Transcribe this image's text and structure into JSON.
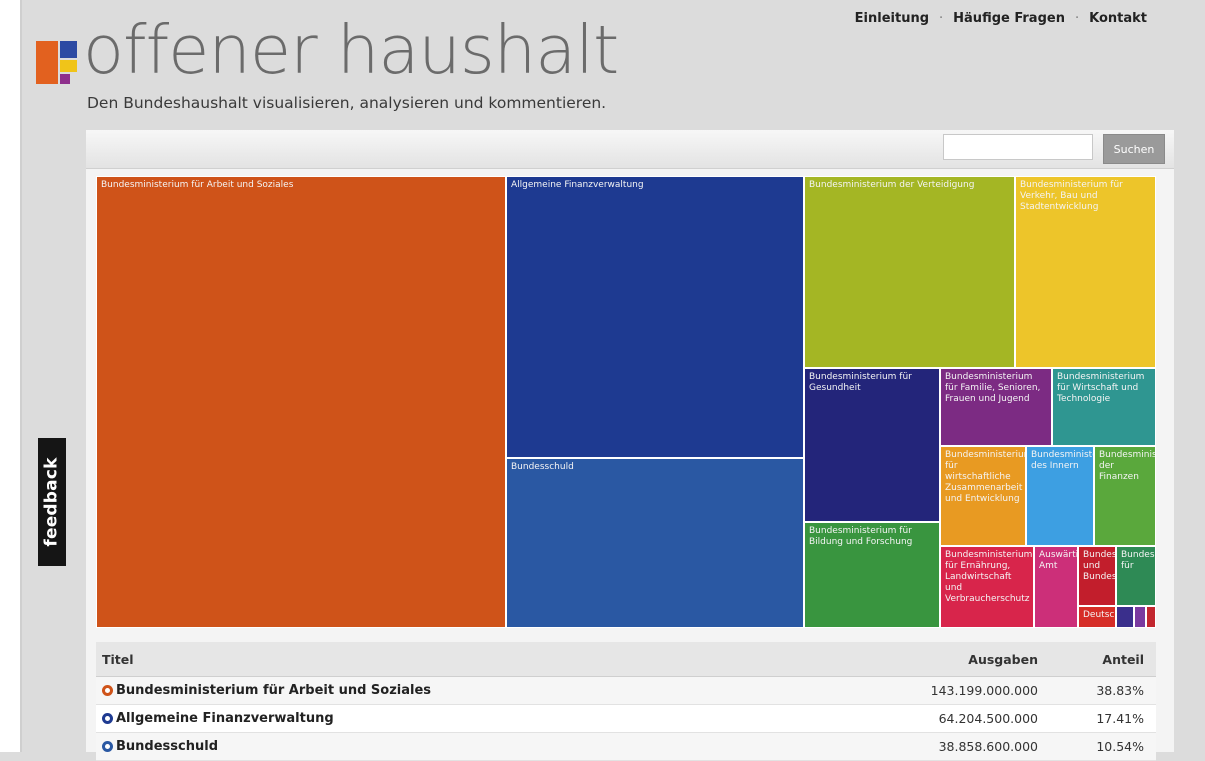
{
  "header": {
    "brand": "offener haushalt",
    "tagline": "Den Bundeshaushalt visualisieren, analysieren und kommentieren.",
    "nav": [
      "Einleitung",
      "Häufige Fragen",
      "Kontakt"
    ],
    "nav_separator": "·",
    "logo_colors": [
      "#e2611f",
      "#2c4aa3",
      "#f0c419",
      "#8e2f8c"
    ]
  },
  "feedback": {
    "label": "feedback"
  },
  "search": {
    "placeholder": "",
    "button_label": "Suchen"
  },
  "chart_data": {
    "type": "treemap",
    "tiles": [
      {
        "label": "Bundesministerium für Arbeit und Soziales",
        "color": "#cf5319"
      },
      {
        "label": "Allgemeine Finanzverwaltung",
        "color": "#1e3a91"
      },
      {
        "label": "Bundesschuld",
        "color": "#2a58a3"
      },
      {
        "label": "Bundesministerium der Verteidigung",
        "color": "#a4b624"
      },
      {
        "label": "Bundesministerium für Verkehr, Bau und Stadtentwicklung",
        "color": "#edc52a"
      },
      {
        "label": "Bundesministerium für Gesundheit",
        "color": "#23257a"
      },
      {
        "label": "Bundesministerium für Bildung und Forschung",
        "color": "#39953f"
      },
      {
        "label": "Bundesministerium für Familie, Senioren, Frauen und Jugend",
        "color": "#7c2b83"
      },
      {
        "label": "Bundesministerium für Wirtschaft und Technologie",
        "color": "#2f9691"
      },
      {
        "label": "Bundesministerium für wirtschaftliche Zusammenarbeit und Entwicklung",
        "color": "#e89a22"
      },
      {
        "label": "Bundesministerium des Innern",
        "color": "#3d9fe2"
      },
      {
        "label": "Bundesministerium der Finanzen",
        "color": "#5aa83c"
      },
      {
        "label": "Bundesministerium für Ernährung, Landwirtschaft und Verbraucherschutz",
        "color": "#d8254b"
      },
      {
        "label": "Auswärtiges Amt",
        "color": "#cc2f79"
      },
      {
        "label": "Bundesministerium und Bundes",
        "color": "#c21e2c"
      },
      {
        "label": "Bundesministerium für",
        "color": "#2e8a55"
      },
      {
        "label": "Deutscher",
        "color": "#d62d27"
      },
      {
        "label": "",
        "color": "#3a2f8c"
      },
      {
        "label": "",
        "color": "#7a3aa0"
      },
      {
        "label": "",
        "color": "#c2262e"
      }
    ]
  },
  "table": {
    "headers": {
      "title": "Titel",
      "amount": "Ausgaben",
      "share": "Anteil"
    },
    "rows": [
      {
        "title": "Bundesministerium für Arbeit und Soziales",
        "amount": "143.199.000.000",
        "share": "38.83%",
        "color": "#cf5319"
      },
      {
        "title": "Allgemeine Finanzverwaltung",
        "amount": "64.204.500.000",
        "share": "17.41%",
        "color": "#1e3a91"
      },
      {
        "title": "Bundesschuld",
        "amount": "38.858.600.000",
        "share": "10.54%",
        "color": "#2a58a3"
      }
    ]
  }
}
